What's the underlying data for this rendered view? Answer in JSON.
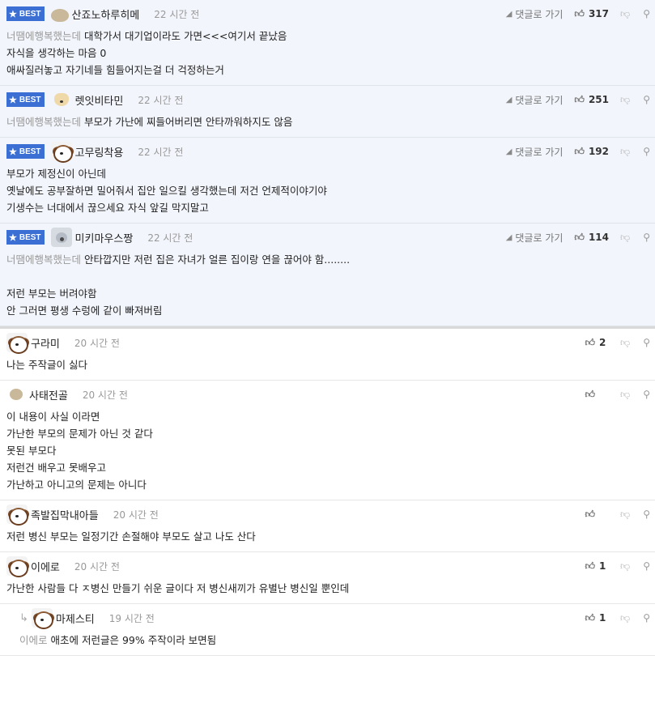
{
  "best_badge": "BEST",
  "reply_link_label": "댓글로 가기",
  "best_comments": [
    {
      "nick": "산죠노하루히메",
      "time": "22 시간 전",
      "likes": "317",
      "avatar": "blob-avatar",
      "lines": [
        {
          "ref": "너땜에행복했는데",
          "text": "대학가서 대기업이라도 가면<<<여기서 끝났음"
        },
        {
          "ref": "",
          "text": "자식을 생각하는 마음 0"
        },
        {
          "ref": "",
          "text": "애싸질러놓고 자기네들 힘들어지는걸 더 걱정하는거"
        }
      ]
    },
    {
      "nick": "렛잇비타민",
      "time": "22 시간 전",
      "likes": "251",
      "avatar": "chihuahua-avatar",
      "lines": [
        {
          "ref": "너땜에행복했는데",
          "text": "부모가 가난에 찌들어버리면 안타까워하지도 않음"
        }
      ]
    },
    {
      "nick": "고무링착용",
      "time": "22 시간 전",
      "likes": "192",
      "avatar": "dog-avatar",
      "lines": [
        {
          "ref": "",
          "text": "부모가 제정신이 아닌데"
        },
        {
          "ref": "",
          "text": "옛날에도 공부잘하면 밀어줘서 집안 일으킬 생각했는데 저건 언제적이야기야"
        },
        {
          "ref": "",
          "text": "기생수는 너대에서 끊으세요 자식 앞길 막지말고"
        }
      ]
    },
    {
      "nick": "미키마우스짱",
      "time": "22 시간 전",
      "likes": "114",
      "avatar": "koala-avatar",
      "lines": [
        {
          "ref": "너땜에행복했는데",
          "text": "안타깝지만 저런 집은 자녀가 얼른 집이랑 연을 끊어야 함........"
        },
        {
          "ref": "",
          "text": ""
        },
        {
          "ref": "",
          "text": "저런 부모는 버려야함"
        },
        {
          "ref": "",
          "text": "안 그러면 평생 수렁에 같이 빠져버림"
        }
      ]
    }
  ],
  "comments": [
    {
      "nick": "구라미",
      "time": "20 시간 전",
      "likes": "2",
      "avatar": "dog-avatar",
      "lines": [
        {
          "ref": "",
          "text": "나는 주작글이 싫다"
        }
      ]
    },
    {
      "nick": "사태전골",
      "time": "20 시간 전",
      "likes": "",
      "avatar": "small-blob-avatar",
      "lines": [
        {
          "ref": "",
          "text": "이 내용이 사실 이라면"
        },
        {
          "ref": "",
          "text": "가난한 부모의 문제가 아닌 것 같다"
        },
        {
          "ref": "",
          "text": "못된 부모다"
        },
        {
          "ref": "",
          "text": "저런건 배우고 못배우고"
        },
        {
          "ref": "",
          "text": "가난하고 아니고의 문제는 아니다"
        }
      ]
    },
    {
      "nick": "족발집막내아들",
      "time": "20 시간 전",
      "likes": "",
      "avatar": "dog-avatar",
      "lines": [
        {
          "ref": "",
          "text": "저런 병신 부모는 일정기간 손절해야 부모도 살고 나도 산다"
        }
      ]
    },
    {
      "nick": "이에로",
      "time": "20 시간 전",
      "likes": "1",
      "avatar": "dog-avatar",
      "lines": [
        {
          "ref": "",
          "text": "가난한 사람들 다 ㅈ병신 만들기 쉬운 글이다 저 병신새끼가 유별난 병신일 뿐인데"
        }
      ]
    }
  ],
  "reply": {
    "nick": "마제스티",
    "time": "19 시간 전",
    "likes": "1",
    "avatar": "dog-avatar",
    "lines": [
      {
        "ref": "이에로",
        "text": "애초에 저런글은 99% 주작이라 보면됨"
      }
    ]
  }
}
